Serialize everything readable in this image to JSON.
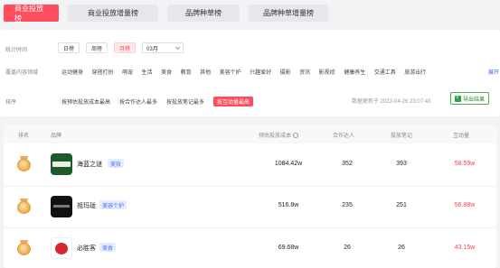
{
  "tabs": [
    {
      "label": "商业投放榜",
      "active": true
    },
    {
      "label": "商业投放增量榜",
      "active": false
    },
    {
      "label": "品牌种草榜",
      "active": false
    },
    {
      "label": "品牌种草增量榜",
      "active": false
    }
  ],
  "filters": {
    "period": {
      "label": "统计时间",
      "options": [
        "日榜",
        "周榜",
        "月榜"
      ],
      "selected": "月榜",
      "month_value": "03月"
    },
    "category": {
      "label": "覆盖内容领域",
      "options": [
        "运动健身",
        "穿搭打扮",
        "萌宠",
        "生活",
        "美食",
        "教育",
        "其他",
        "美容个护",
        "兴趣爱好",
        "摄影",
        "资讯",
        "影视综",
        "健康养生",
        "交通工具",
        "旅游出行"
      ],
      "expand_label": "展开"
    },
    "sort": {
      "label": "排序",
      "options": [
        "按预估投放成本最高",
        "按合作达人最多",
        "按投放笔记最多",
        "按互动量最高"
      ],
      "selected": "按互动量最高"
    },
    "update_time": "数据更新于 2022-04-26 23:07:43",
    "export_label": "导出结果"
  },
  "table": {
    "columns": {
      "rank": "排名",
      "brand": "品牌",
      "cost": "预估投放成本",
      "creators": "合作达人",
      "notes": "投放笔记",
      "interactions": "互动量"
    },
    "rows": [
      {
        "brand": "海蓝之谜",
        "category": "美妆",
        "cost": "1084.42w",
        "creators": "352",
        "notes": "393",
        "interactions": "58.59w"
      },
      {
        "brand": "祖玛珑",
        "category": "美容个护",
        "cost": "516.8w",
        "creators": "235",
        "notes": "251",
        "interactions": "56.88w"
      },
      {
        "brand": "必胜客",
        "category": "美食",
        "cost": "69.68w",
        "creators": "26",
        "notes": "26",
        "interactions": "43.15w"
      }
    ]
  },
  "colors": {
    "accent": "#ff4d5e",
    "interaction_value": "#ff3b4a",
    "tag_bg": "#e6ecff",
    "tag_text": "#4a6cf7"
  }
}
